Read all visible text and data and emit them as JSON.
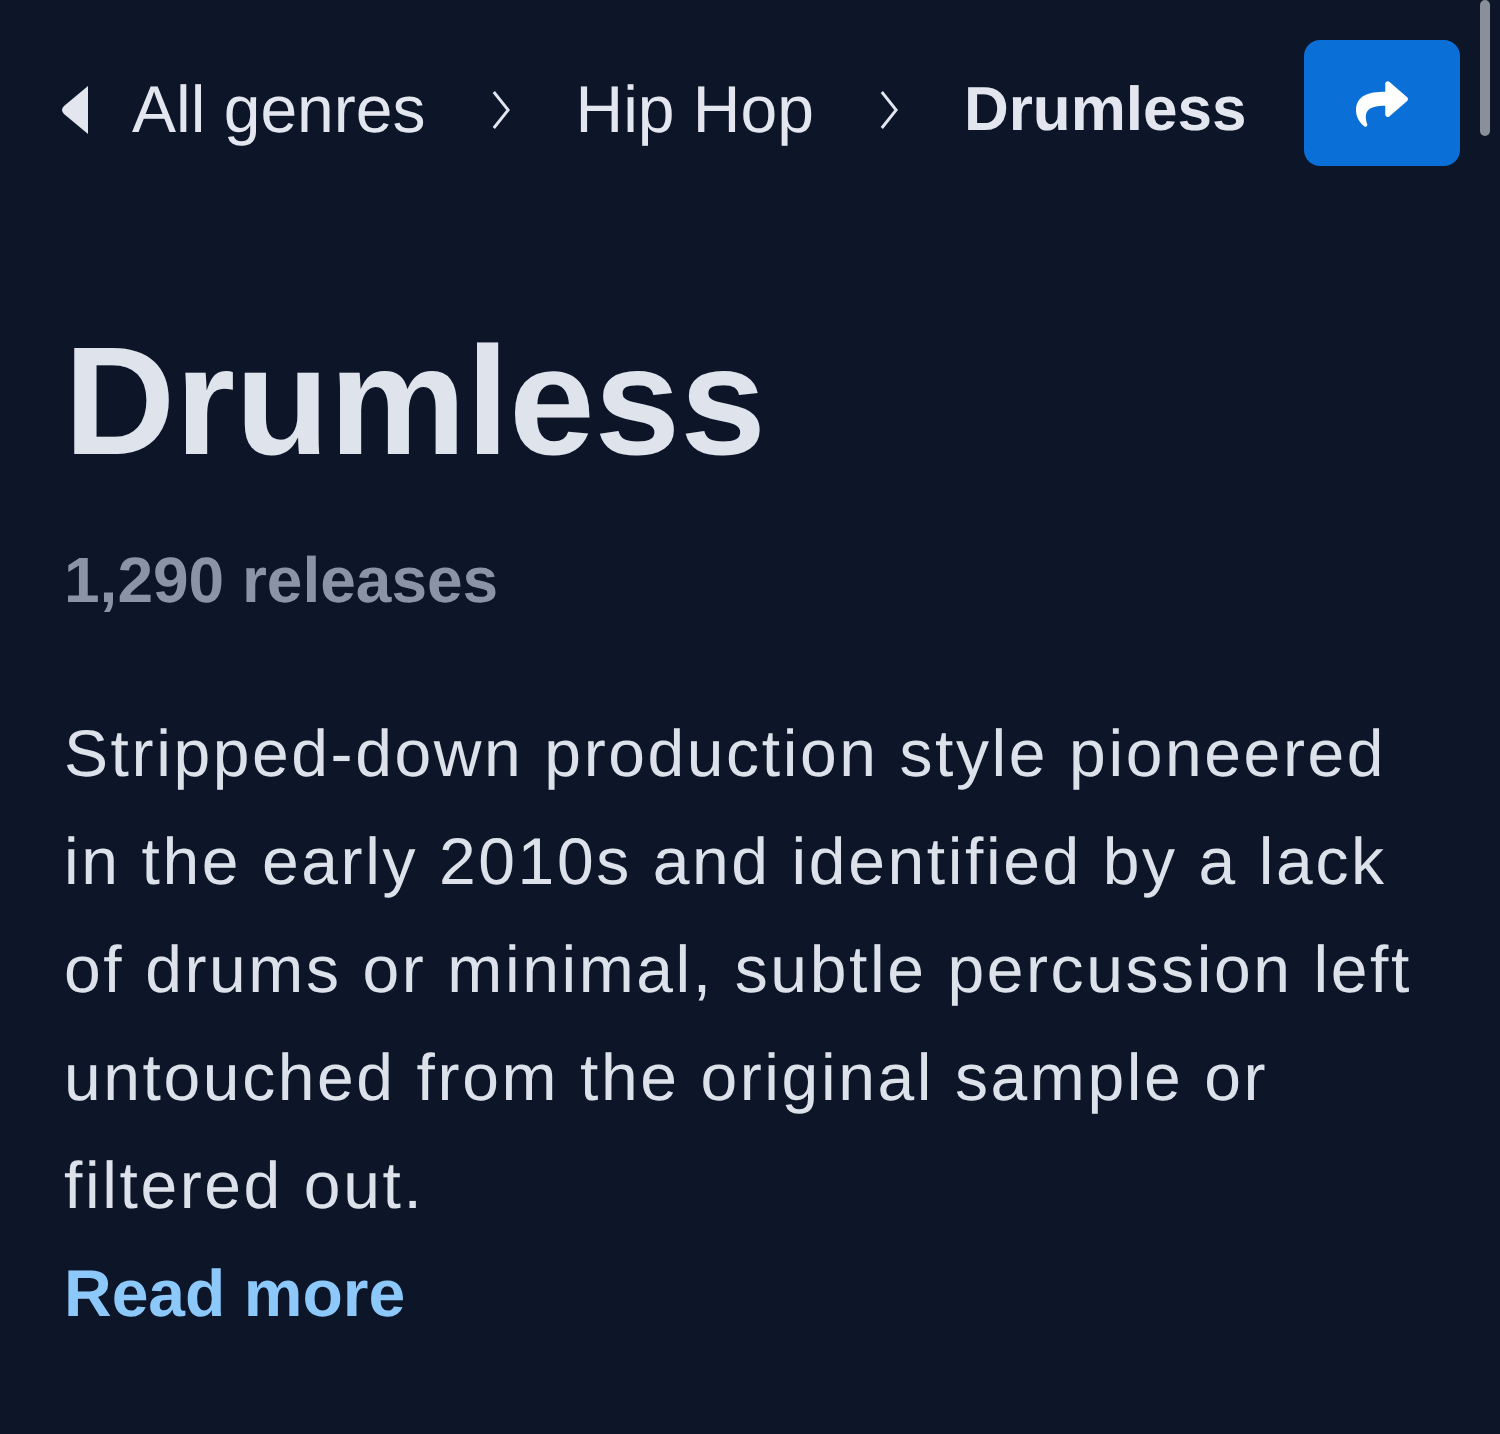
{
  "breadcrumb": [
    {
      "label": "All genres",
      "current": false
    },
    {
      "label": "Hip Hop",
      "current": false
    },
    {
      "label": "Drumless",
      "current": true
    }
  ],
  "title": "Drumless",
  "release_count": "1,290 releases",
  "description": "Stripped-down production style pioneered in the early 2010s and identified by a lack of drums or minimal, subtle percussion left untouched from the original sample or filtered out.",
  "read_more": "Read more"
}
